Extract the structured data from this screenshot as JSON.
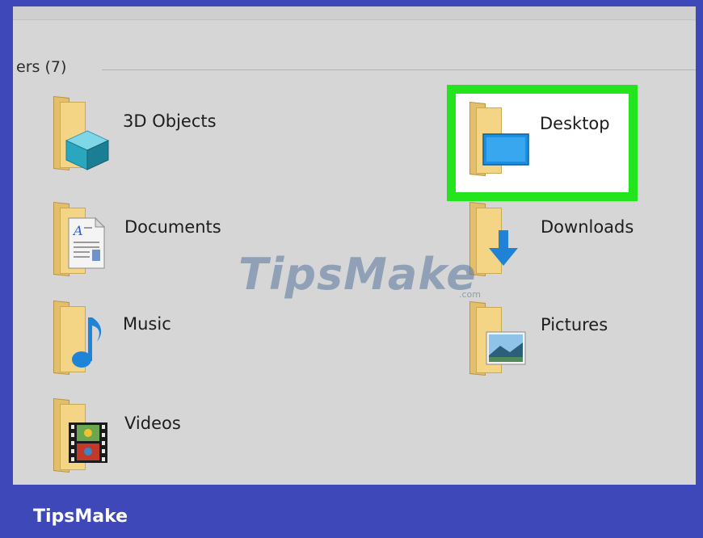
{
  "section": {
    "header": "ers (7)"
  },
  "folders": [
    {
      "label": "3D Objects",
      "overlay": "cube-icon"
    },
    {
      "label": "Desktop",
      "overlay": "monitor-icon",
      "selected": true
    },
    {
      "label": "Documents",
      "overlay": "document-icon"
    },
    {
      "label": "Downloads",
      "overlay": "download-arrow-icon"
    },
    {
      "label": "Music",
      "overlay": "music-note-icon"
    },
    {
      "label": "Pictures",
      "overlay": "landscape-picture-icon"
    },
    {
      "label": "Videos",
      "overlay": "film-strip-icon"
    }
  ],
  "watermark": {
    "text": "TipsMake",
    "suffix": ".com"
  },
  "footer": {
    "brand": "TipsMake"
  },
  "colors": {
    "frame": "#3f48b8",
    "window": "#d6d6d6",
    "selection_highlight": "#23e51e",
    "folder": "#f3d585"
  }
}
